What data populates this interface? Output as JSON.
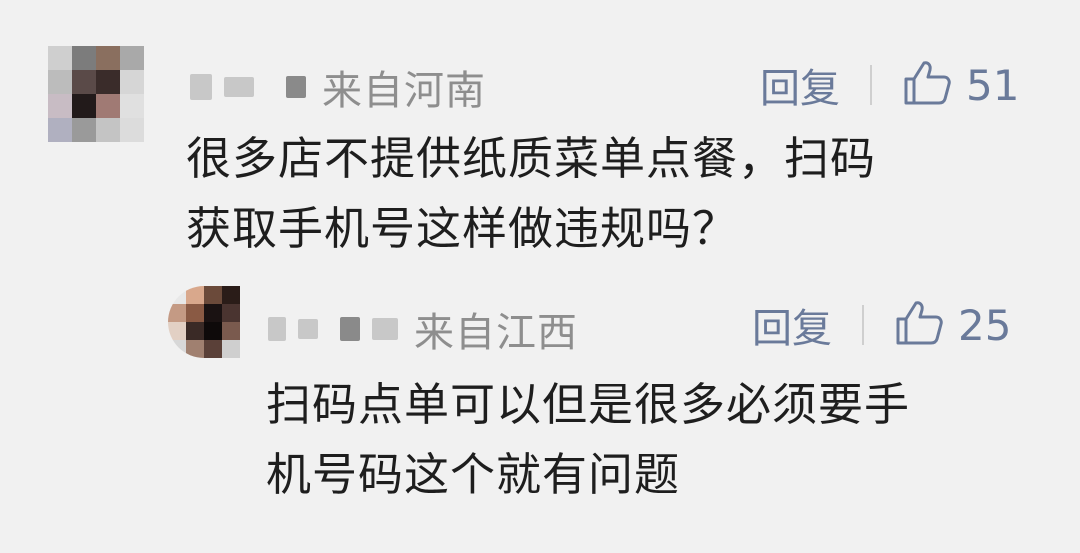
{
  "comments": [
    {
      "location": "来自河南",
      "reply_label": "回复",
      "like_count": "51",
      "text_lines": [
        "很多店不提供纸质菜单点餐，扫码",
        "获取手机号这样做违规吗？"
      ],
      "avatar_colors": [
        "#cfcfcf",
        "#7c7c7c",
        "#8a6f5f",
        "#a9a9a9",
        "#bcbcbc",
        "#5a4a48",
        "#3a2c2a",
        "#d6d6d6",
        "#c8bcc4",
        "#221a1a",
        "#a07a74",
        "#e0e0e0",
        "#b0b0c0",
        "#9a9a9a",
        "#c4c4c4",
        "#dcdcdc"
      ],
      "replies": [
        {
          "location": "来自江西",
          "reply_label": "回复",
          "like_count": "25",
          "text_lines": [
            "扫码点单可以但是很多必须要手",
            "机号码这个就有问题"
          ],
          "avatar_colors": [
            "#e8e8e8",
            "#d9a88c",
            "#6b4a3a",
            "#2a1c18",
            "#c49a84",
            "#8a5a44",
            "#1a1212",
            "#4a3430",
            "#e2d0c4",
            "#3a2a26",
            "#0e0a0a",
            "#7a5a4e",
            "#d8d8d8",
            "#a08070",
            "#5a4038",
            "#cfcfcf"
          ]
        }
      ]
    }
  ],
  "colors": {
    "background": "#f1f1f1",
    "text": "#1e1e1e",
    "meta": "#8e8e8e",
    "action": "#6a7a9a"
  }
}
